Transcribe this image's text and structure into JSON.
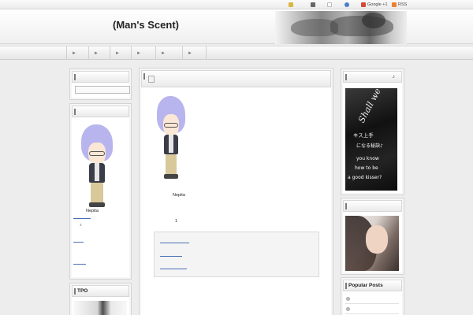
{
  "topbar": {
    "links": [
      {
        "label": "",
        "icon": "pencil-icon",
        "color": "#d9b640"
      },
      {
        "label": "",
        "icon": "user-icon",
        "color": "#666666"
      },
      {
        "label": "",
        "icon": "page-icon",
        "color": "#bbbbbb"
      },
      {
        "label": "",
        "icon": "globe-icon",
        "color": "#4a7fc4"
      },
      {
        "label": "Google +1",
        "icon": "google-plus-icon",
        "color": "#d34836"
      },
      {
        "label": "RSS",
        "icon": "rss-icon",
        "color": "#ee802f"
      }
    ]
  },
  "header": {
    "title": "(Man's Scent)"
  },
  "nav": {
    "arrow": "►",
    "tabs": [
      "",
      "",
      "",
      "",
      "",
      ""
    ]
  },
  "left": {
    "search_widget": {
      "title": ""
    },
    "profile_widget": {
      "title": "",
      "name": "Nepita",
      "note": "♪"
    },
    "tpo_widget": {
      "title": "TPO"
    }
  },
  "main": {
    "post_icon": "page-icon",
    "caption": "Nepita",
    "count": "1"
  },
  "right": {
    "kiss_widget": {
      "title": "♪",
      "image_text": {
        "script": "Shall we kiss?",
        "line1": "キス上手",
        "line2": "になる秘訣♪",
        "line3": "you know",
        "line4": "how to be",
        "line5": "a good kisser?"
      }
    },
    "photo_widget": {
      "title": ""
    },
    "popular": {
      "title": "Popular Posts",
      "items": [
        "",
        ""
      ]
    }
  },
  "colors": {
    "link": "#4a6fb5",
    "background": "#ededed"
  }
}
